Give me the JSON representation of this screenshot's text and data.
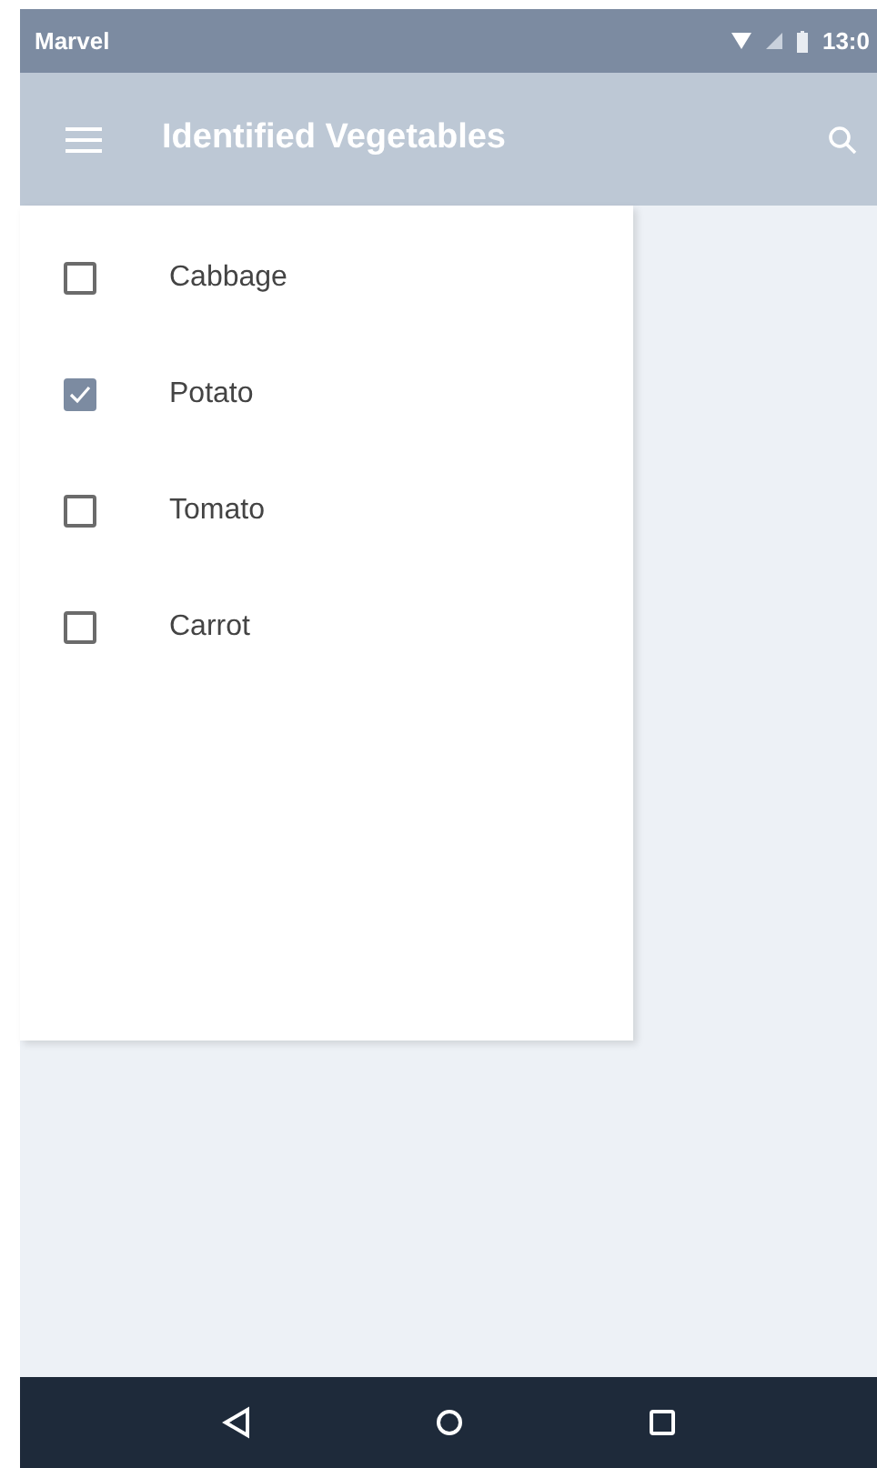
{
  "status_bar": {
    "carrier": "Marvel",
    "time": "13:0"
  },
  "app_bar": {
    "title": "Identified Vegetables"
  },
  "items": [
    {
      "label": "Cabbage",
      "checked": false
    },
    {
      "label": "Potato",
      "checked": true
    },
    {
      "label": "Tomato",
      "checked": false
    },
    {
      "label": "Carrot",
      "checked": false
    }
  ]
}
